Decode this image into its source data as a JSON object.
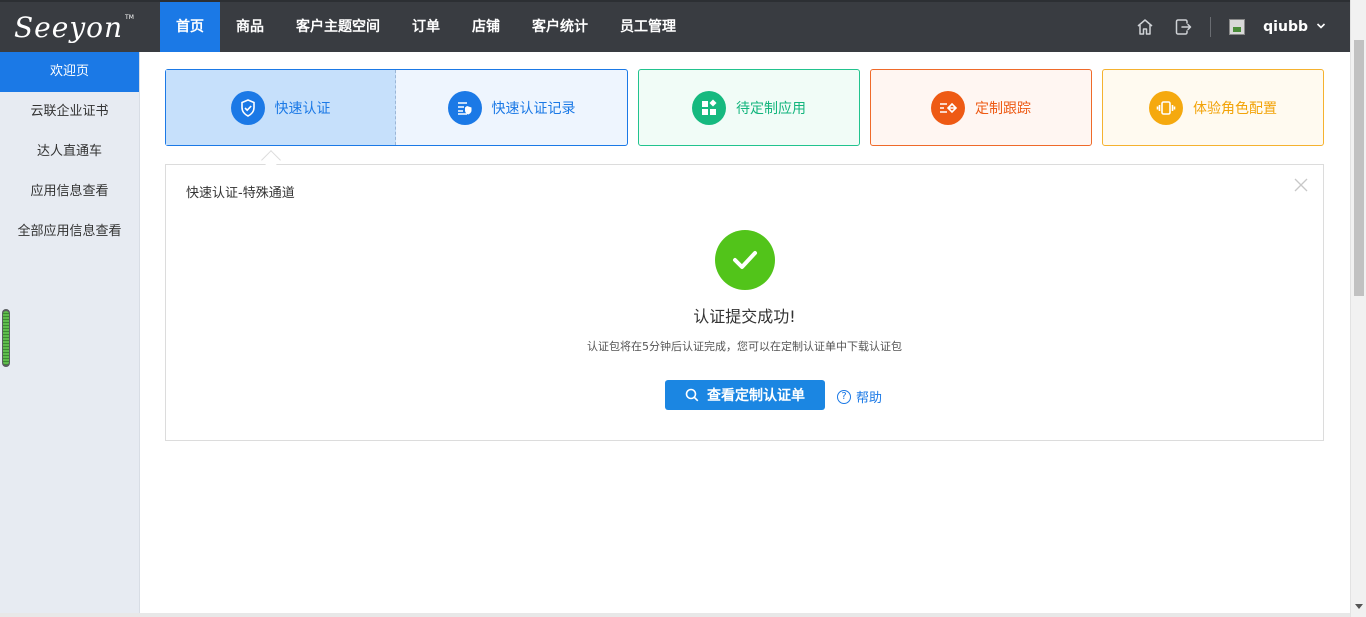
{
  "brand": {
    "logo_text": "Seeyon",
    "logo_mark": "TM"
  },
  "nav": {
    "items": [
      {
        "label": "首页",
        "active": true
      },
      {
        "label": "商品"
      },
      {
        "label": "客户主题空间"
      },
      {
        "label": "订单"
      },
      {
        "label": "店铺"
      },
      {
        "label": "客户统计"
      },
      {
        "label": "员工管理"
      }
    ]
  },
  "header": {
    "icons": [
      "home-icon",
      "logout-icon"
    ],
    "username": "qiubb",
    "dropdown_icon": "chevron-down-icon"
  },
  "sidebar": {
    "items": [
      {
        "label": "欢迎页",
        "active": true
      },
      {
        "label": "云联企业证书"
      },
      {
        "label": "达人直通车"
      },
      {
        "label": "应用信息查看"
      },
      {
        "label": "全部应用信息查看"
      }
    ]
  },
  "cards": {
    "quick_auth": {
      "label": "快速认证",
      "icon": "shield-check-icon",
      "color": "#1b79e6"
    },
    "quick_auth_record": {
      "label": "快速认证记录",
      "icon": "record-check-icon",
      "color": "#1b79e6"
    },
    "custom_apps": {
      "label": "待定制应用",
      "icon": "apps-grid-icon",
      "color": "#13b57d"
    },
    "custom_tracking": {
      "label": "定制跟踪",
      "icon": "tracking-icon",
      "color": "#ee5a14"
    },
    "role_config": {
      "label": "体验角色配置",
      "icon": "vibrate-icon",
      "color": "#f2a308"
    }
  },
  "panel": {
    "title": "快速认证-特殊通道",
    "close_icon": "close-icon",
    "success_icon": "check-circle-icon",
    "success_title": "认证提交成功!",
    "success_message": "认证包将在5分钟后认证完成，您可以在定制认证单中下载认证包",
    "primary_button": "查看定制认证单",
    "help_link": "帮助"
  },
  "colors": {
    "topbar": "#393c41",
    "accent": "#1b79e6",
    "success": "#52c41a",
    "sidebar_bg": "#e7ebf2"
  }
}
